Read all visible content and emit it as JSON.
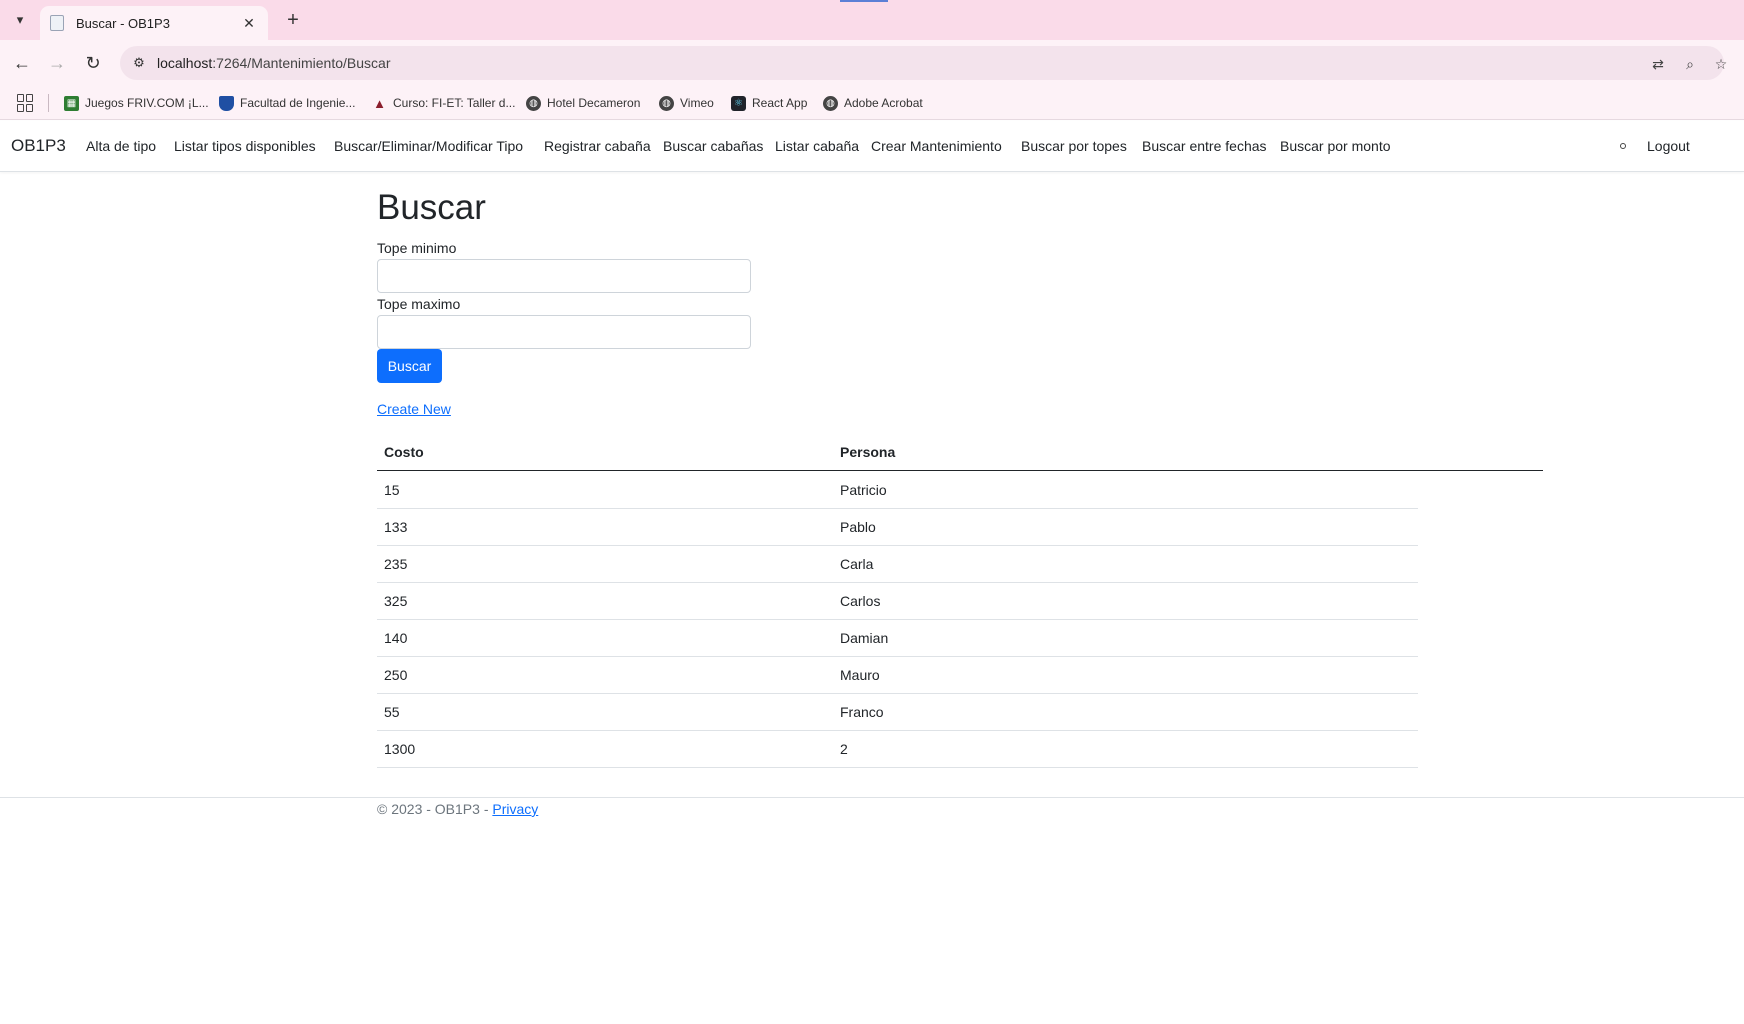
{
  "browser": {
    "tab_title": "Buscar - OB1P3",
    "url_host": "localhost",
    "url_path": ":7264/Mantenimiento/Buscar",
    "bookmarks": [
      {
        "label": "Juegos FRIV.COM ¡L...",
        "icon": "friv-icon",
        "color": "#2e7d32"
      },
      {
        "label": "Facultad de Ingenie...",
        "icon": "shield-icon",
        "color": "#1f4fa3"
      },
      {
        "label": "Curso: FI-ET: Taller d...",
        "icon": "graduation-cap-icon",
        "color": "#8b1e2d"
      },
      {
        "label": "Hotel Decameron",
        "icon": "globe-icon",
        "color": "#444444"
      },
      {
        "label": "Vimeo",
        "icon": "globe-icon",
        "color": "#444444"
      },
      {
        "label": "React App",
        "icon": "react-icon",
        "color": "#20232a"
      },
      {
        "label": "Adobe Acrobat",
        "icon": "globe-icon",
        "color": "#444444"
      }
    ]
  },
  "navbar": {
    "brand": "OB1P3",
    "links": [
      "Alta de tipo",
      "Listar tipos disponibles",
      "Buscar/Eliminar/Modificar Tipo",
      "Registrar cabaña",
      "Buscar cabañas",
      "Listar cabaña",
      "Crear Mantenimiento",
      "Buscar por topes",
      "Buscar entre fechas",
      "Buscar por monto"
    ],
    "logout": "Logout"
  },
  "page": {
    "title": "Buscar",
    "min_label": "Tope minimo",
    "min_value": "",
    "max_label": "Tope maximo",
    "max_value": "",
    "search_button": "Buscar",
    "create_link": "Create New"
  },
  "table": {
    "headers": [
      "Costo",
      "Persona"
    ],
    "rows": [
      [
        "15",
        "Patricio"
      ],
      [
        "133",
        "Pablo"
      ],
      [
        "235",
        "Carla"
      ],
      [
        "325",
        "Carlos"
      ],
      [
        "140",
        "Damian"
      ],
      [
        "250",
        "Mauro"
      ],
      [
        "55",
        "Franco"
      ],
      [
        "1300",
        "2"
      ]
    ]
  },
  "footer": {
    "text": "© 2023 - OB1P3 - ",
    "privacy": "Privacy"
  },
  "colors": {
    "accent": "#0d6efd",
    "tabstrip": "#fadbe9"
  }
}
